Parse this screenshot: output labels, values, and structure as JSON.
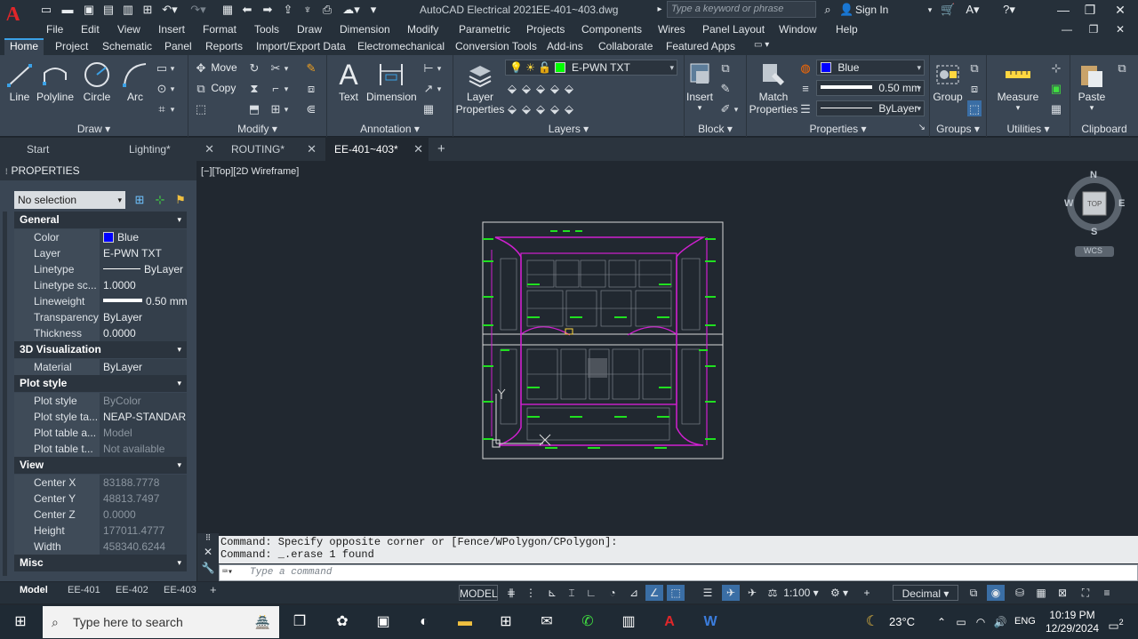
{
  "titlebar": {
    "app": "AutoCAD Electrical 2021",
    "file": "EE-401~403.dwg",
    "search_placeholder": "Type a keyword or phrase",
    "signin": "Sign In"
  },
  "menu": [
    "File",
    "Edit",
    "View",
    "Insert",
    "Format",
    "Tools",
    "Draw",
    "Dimension",
    "Modify",
    "Parametric",
    "Projects",
    "Components",
    "Wires",
    "Panel Layout",
    "Window",
    "Help"
  ],
  "ribbon_tabs": [
    "Home",
    "Project",
    "Schematic",
    "Panel",
    "Reports",
    "Import/Export Data",
    "Electromechanical",
    "Conversion Tools",
    "Add-ins",
    "Collaborate",
    "Featured Apps"
  ],
  "ribbon": {
    "draw": {
      "title": "Draw",
      "line": "Line",
      "polyline": "Polyline",
      "circle": "Circle",
      "arc": "Arc"
    },
    "modify": {
      "title": "Modify",
      "move": "Move",
      "copy": "Copy"
    },
    "annotation": {
      "title": "Annotation",
      "text": "Text",
      "dimension": "Dimension"
    },
    "layers": {
      "title": "Layers",
      "layer_properties": "Layer Properties",
      "current_layer": "E-PWN TXT"
    },
    "block": {
      "title": "Block",
      "insert": "Insert"
    },
    "properties": {
      "title": "Properties",
      "match": "Match Properties",
      "color": "Blue",
      "lineweight": "0.50 mm",
      "linetype": "ByLayer"
    },
    "groups": {
      "title": "Groups",
      "group": "Group"
    },
    "utilities": {
      "title": "Utilities",
      "measure": "Measure"
    },
    "clipboard": {
      "title": "Clipboard",
      "paste": "Paste"
    }
  },
  "doc_tabs": [
    "Start",
    "Lighting*",
    "ROUTING*",
    "EE-401~403*"
  ],
  "properties_palette": {
    "header": "PROPERTIES",
    "selection": "No selection",
    "sections": [
      {
        "name": "General",
        "rows": [
          {
            "k": "Color",
            "v": "Blue"
          },
          {
            "k": "Layer",
            "v": "E-PWN TXT"
          },
          {
            "k": "Linetype",
            "v": "ByLayer"
          },
          {
            "k": "Linetype sc...",
            "v": "1.0000"
          },
          {
            "k": "Lineweight",
            "v": "0.50 mm"
          },
          {
            "k": "Transparency",
            "v": "ByLayer"
          },
          {
            "k": "Thickness",
            "v": "0.0000"
          }
        ]
      },
      {
        "name": "3D Visualization",
        "rows": [
          {
            "k": "Material",
            "v": "ByLayer"
          }
        ]
      },
      {
        "name": "Plot style",
        "rows": [
          {
            "k": "Plot style",
            "v": "ByColor"
          },
          {
            "k": "Plot style ta...",
            "v": "NEAP-STANDAR..."
          },
          {
            "k": "Plot table a...",
            "v": "Model"
          },
          {
            "k": "Plot table t...",
            "v": "Not available"
          }
        ]
      },
      {
        "name": "View",
        "rows": [
          {
            "k": "Center X",
            "v": "83188.7778"
          },
          {
            "k": "Center Y",
            "v": "48813.7497"
          },
          {
            "k": "Center Z",
            "v": "0.0000"
          },
          {
            "k": "Height",
            "v": "177011.4777"
          },
          {
            "k": "Width",
            "v": "458340.6244"
          }
        ]
      },
      {
        "name": "Misc",
        "rows": []
      }
    ]
  },
  "viewport": {
    "label": "[−][Top][2D Wireframe]",
    "compass": {
      "n": "N",
      "s": "S",
      "e": "E",
      "w": "W",
      "cube": "TOP",
      "wcs": "WCS"
    }
  },
  "command": {
    "line1": "Command: Specify opposite corner or [Fence/WPolygon/CPolygon]:",
    "line2": "Command: _.erase 1 found",
    "placeholder": "Type a command"
  },
  "layout_tabs": [
    "Model",
    "EE-401",
    "EE-402",
    "EE-403"
  ],
  "status": {
    "model": "MODEL",
    "scale": "1:100",
    "units": "Decimal"
  },
  "taskbar": {
    "search": "Type here to search",
    "temp": "23°C",
    "lang": "ENG",
    "time": "10:19 PM",
    "date": "12/29/2024",
    "notif": "2"
  },
  "colors": {
    "accent": "#3ba1e6",
    "bg": "#212830",
    "magenta": "#d020d0",
    "green": "#20e020",
    "blue_swatch": "#0000ff",
    "layer_green": "#00ff00"
  }
}
